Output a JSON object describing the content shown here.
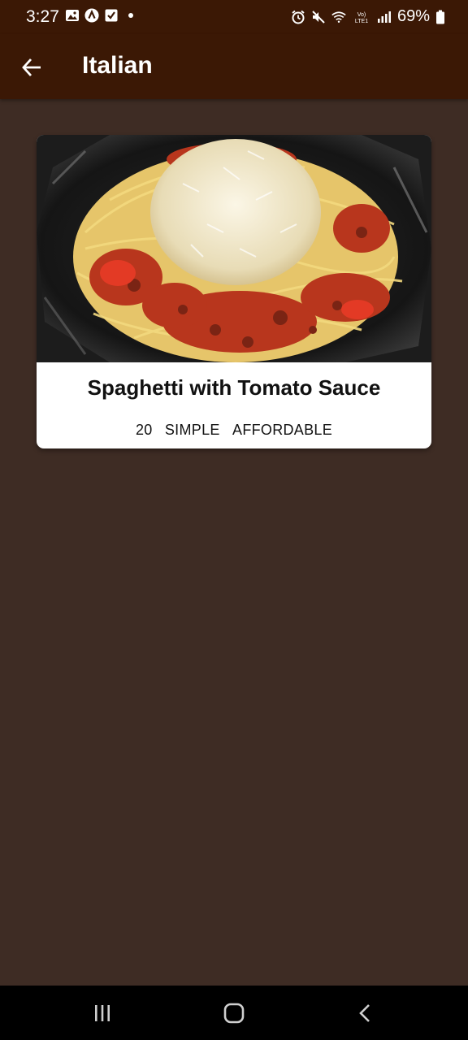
{
  "status_bar": {
    "time": "3:27",
    "battery_percent": "69%",
    "left_icons": [
      "image-icon",
      "a-app-icon",
      "checkbox-icon",
      "dot-icon"
    ],
    "right_icons": [
      "alarm-icon",
      "mute-icon",
      "wifi-icon",
      "volte-icon",
      "signal-icon",
      "battery-icon"
    ],
    "volte_label": "Vo) LTE1"
  },
  "app_bar": {
    "back_icon": "arrow-back-icon",
    "title": "Italian"
  },
  "meals": [
    {
      "title": "Spaghetti with Tomato Sauce",
      "duration": "20",
      "complexity": "SIMPLE",
      "affordability": "AFFORDABLE"
    }
  ],
  "nav_bar": {
    "icons": [
      "recents-icon",
      "home-icon",
      "back-nav-icon"
    ]
  },
  "colors": {
    "app_bar": "#3b1805",
    "background": "#3e2c24",
    "card": "#ffffff",
    "nav_bar": "#000000"
  }
}
